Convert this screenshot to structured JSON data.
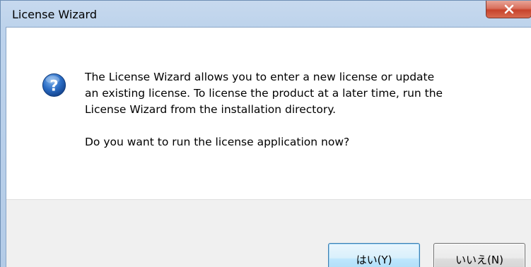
{
  "window": {
    "title": "License Wizard",
    "close_symbol": "X"
  },
  "dialog": {
    "icon": "question-icon",
    "message_line_1": "The License Wizard allows you to enter a new license or update",
    "message_line_2": "an existing license. To license the product at a later time, run the",
    "message_line_3": "License Wizard from the installation directory.",
    "question": "Do you want to run the license application now?"
  },
  "buttons": {
    "yes_label": "はい(Y)",
    "no_label": "いいえ(N)"
  },
  "colors": {
    "titlebar": "#bdd3ec",
    "close_button": "#c7432c",
    "footer": "#f0f0f0",
    "default_button_border": "#3c7fb1",
    "icon_blue": "#1d5fb4"
  }
}
